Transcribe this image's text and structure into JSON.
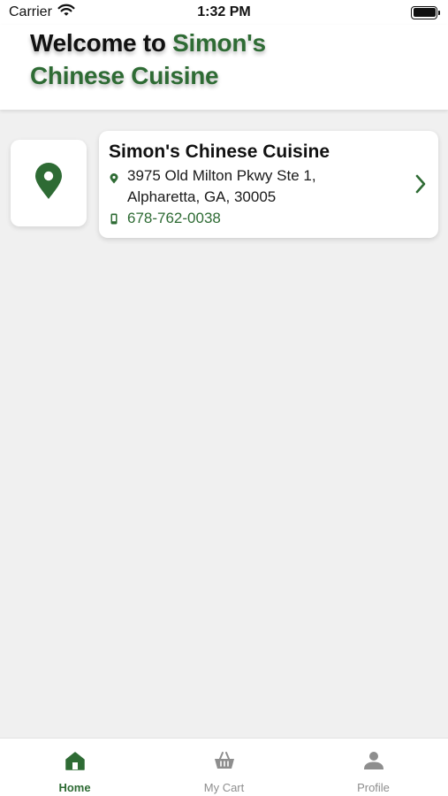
{
  "status_bar": {
    "carrier": "Carrier",
    "time": "1:32 PM",
    "icons": [
      "wifi-icon",
      "battery-icon"
    ]
  },
  "header": {
    "welcome_prefix": "Welcome to ",
    "welcome_accent": "Simon's",
    "welcome_line2": "Chinese Cuisine"
  },
  "store": {
    "name": "Simon's Chinese Cuisine",
    "address_line1": "3975 Old Milton Pkwy Ste 1,",
    "address_line2": "Alpharetta, GA, 30005",
    "phone": "678-762-0038",
    "icons": [
      "map-pin-icon",
      "location-dot-icon",
      "phone-icon",
      "chevron-right-icon"
    ]
  },
  "tab_bar": {
    "tabs": [
      {
        "label": "Home",
        "icon": "home-icon",
        "active": true
      },
      {
        "label": "My Cart",
        "icon": "basket-icon",
        "active": false
      },
      {
        "label": "Profile",
        "icon": "person-icon",
        "active": false
      }
    ]
  },
  "colors": {
    "accent": "#2e6b34",
    "background": "#f0f0f0",
    "inactive": "#8e8e8e"
  }
}
